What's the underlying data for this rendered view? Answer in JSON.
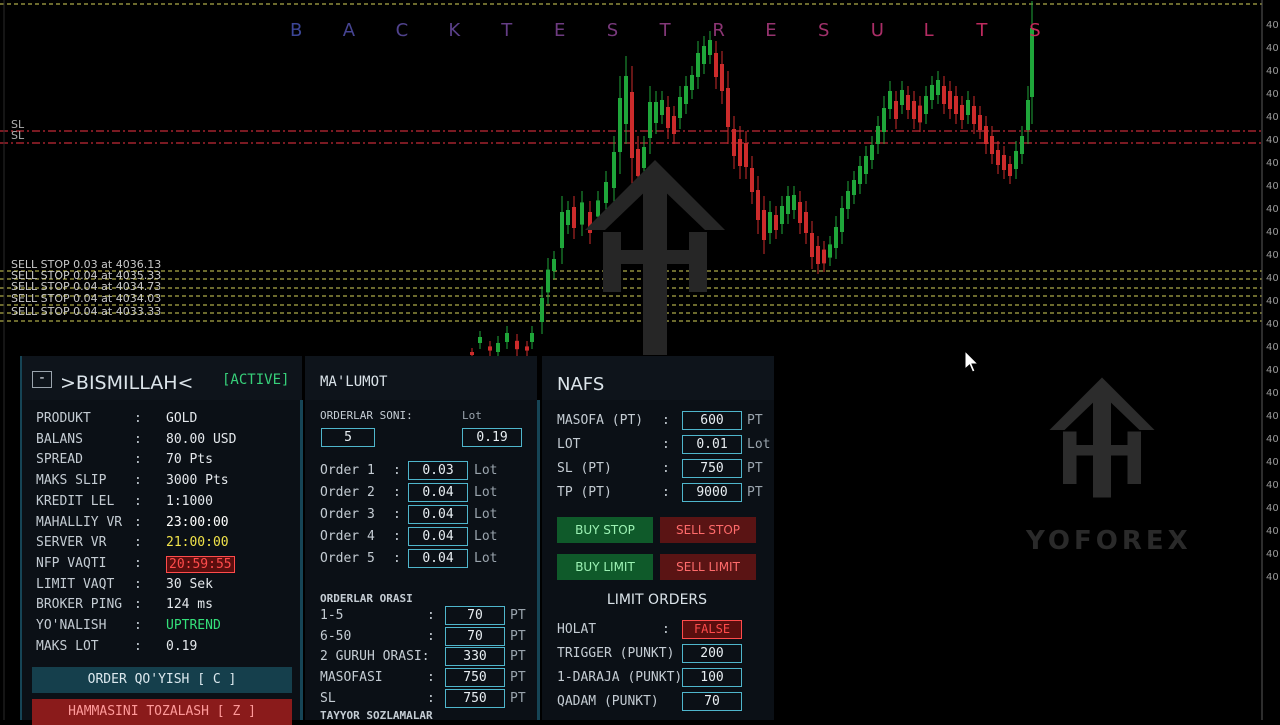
{
  "banner": {
    "letters": [
      "B",
      "A",
      "C",
      "K",
      "T",
      "E",
      "S",
      "T",
      "R",
      "E",
      "S",
      "U",
      "L",
      "T",
      "S"
    ]
  },
  "colors": {
    "accent": "#4fb6cc",
    "bull": "#1fa63a",
    "bear": "#cc2b2b",
    "yellow": "#d7d45a",
    "red_line": "#c42a36",
    "active_green": "#37d07a",
    "uptrend_green": "#34e07a",
    "false_red": "#ff4b4b"
  },
  "chart": {
    "sl_labels": [
      "SL",
      "SL"
    ],
    "sell_stops": [
      "SELL STOP 0.03 at 4036.13",
      "SELL STOP 0.04 at 4035.33",
      "SELL STOP 0.04 at 4034.73",
      "SELL STOP 0.04 at 4034.03",
      "SELL STOP 0.04 at 4033.33"
    ],
    "axis_tick": "40"
  },
  "watermark": {
    "text": "YOFOREX",
    "icon": "logo-house-icon"
  },
  "panel1": {
    "minimize": "-",
    "title": ">BISMILLAH<",
    "status": "[ACTIVE]",
    "rows": [
      {
        "label": "PRODUKT",
        "value": "GOLD"
      },
      {
        "label": "BALANS",
        "value": "80.00 USD"
      },
      {
        "label": "SPREAD",
        "value": "70 Pts"
      },
      {
        "label": "MAKS SLIP",
        "value": "3000 Pts"
      },
      {
        "label": "KREDIT LEL",
        "value": "1:1000"
      },
      {
        "label": "MAHALLIY VR",
        "value": "23:00:00"
      },
      {
        "label": "SERVER VR",
        "value": "21:00:00"
      },
      {
        "label": "NFP VAQTI",
        "value": "20:59:55"
      },
      {
        "label": "LIMIT VAQT",
        "value": "30 Sek"
      },
      {
        "label": "BROKER PING",
        "value": "124 ms"
      },
      {
        "label": "YO'NALISH",
        "value": "UPTREND"
      },
      {
        "label": "MAKS LOT",
        "value": "0.19"
      }
    ],
    "order_button": "ORDER QO'YISH [ C ]",
    "clear_button": "HAMMASINI TOZALASH [ Z ]"
  },
  "panel2": {
    "title": "MA'LUMOT",
    "orders_count_label": "ORDERLAR SONI:",
    "lot_label": "Lot",
    "orders_count": "5",
    "total_lot": "0.19",
    "orders": [
      {
        "label": "Order 1",
        "value": "0.03",
        "unit": "Lot"
      },
      {
        "label": "Order 2",
        "value": "0.04",
        "unit": "Lot"
      },
      {
        "label": "Order 3",
        "value": "0.04",
        "unit": "Lot"
      },
      {
        "label": "Order 4",
        "value": "0.04",
        "unit": "Lot"
      },
      {
        "label": "Order 5",
        "value": "0.04",
        "unit": "Lot"
      }
    ],
    "spacing_title": "ORDERLAR ORASI",
    "spacing": [
      {
        "label": "1-5",
        "value": "70",
        "unit": "PT"
      },
      {
        "label": "6-50",
        "value": "70",
        "unit": "PT"
      },
      {
        "label": "2 GURUH ORASI:",
        "value": "330",
        "unit": "PT"
      },
      {
        "label": "MASOFASI",
        "value": "750",
        "unit": "PT"
      },
      {
        "label": "SL",
        "value": "750",
        "unit": "PT"
      }
    ],
    "ready_settings": "TAYYOR SOZLAMALAR"
  },
  "panel3": {
    "title": "NAFS",
    "fields": [
      {
        "label": "MASOFA (PT)",
        "value": "600",
        "unit": "PT"
      },
      {
        "label": "LOT",
        "value": "0.01",
        "unit": "Lot"
      },
      {
        "label": "SL (PT)",
        "value": "750",
        "unit": "PT"
      },
      {
        "label": "TP (PT)",
        "value": "9000",
        "unit": "PT"
      }
    ],
    "buy_stop": "BUY STOP",
    "sell_stop": "SELL STOP",
    "buy_limit": "BUY LIMIT",
    "sell_limit": "SELL LIMIT",
    "limit_orders_title": "LIMIT ORDERS",
    "limit_fields": [
      {
        "label": "HOLAT",
        "value": "FALSE"
      },
      {
        "label": "TRIGGER (PUNKT)",
        "value": "200"
      },
      {
        "label": "1-DARAJA (PUNKT)",
        "value": "100"
      },
      {
        "label": "QADAM (PUNKT)",
        "value": "70"
      }
    ]
  }
}
